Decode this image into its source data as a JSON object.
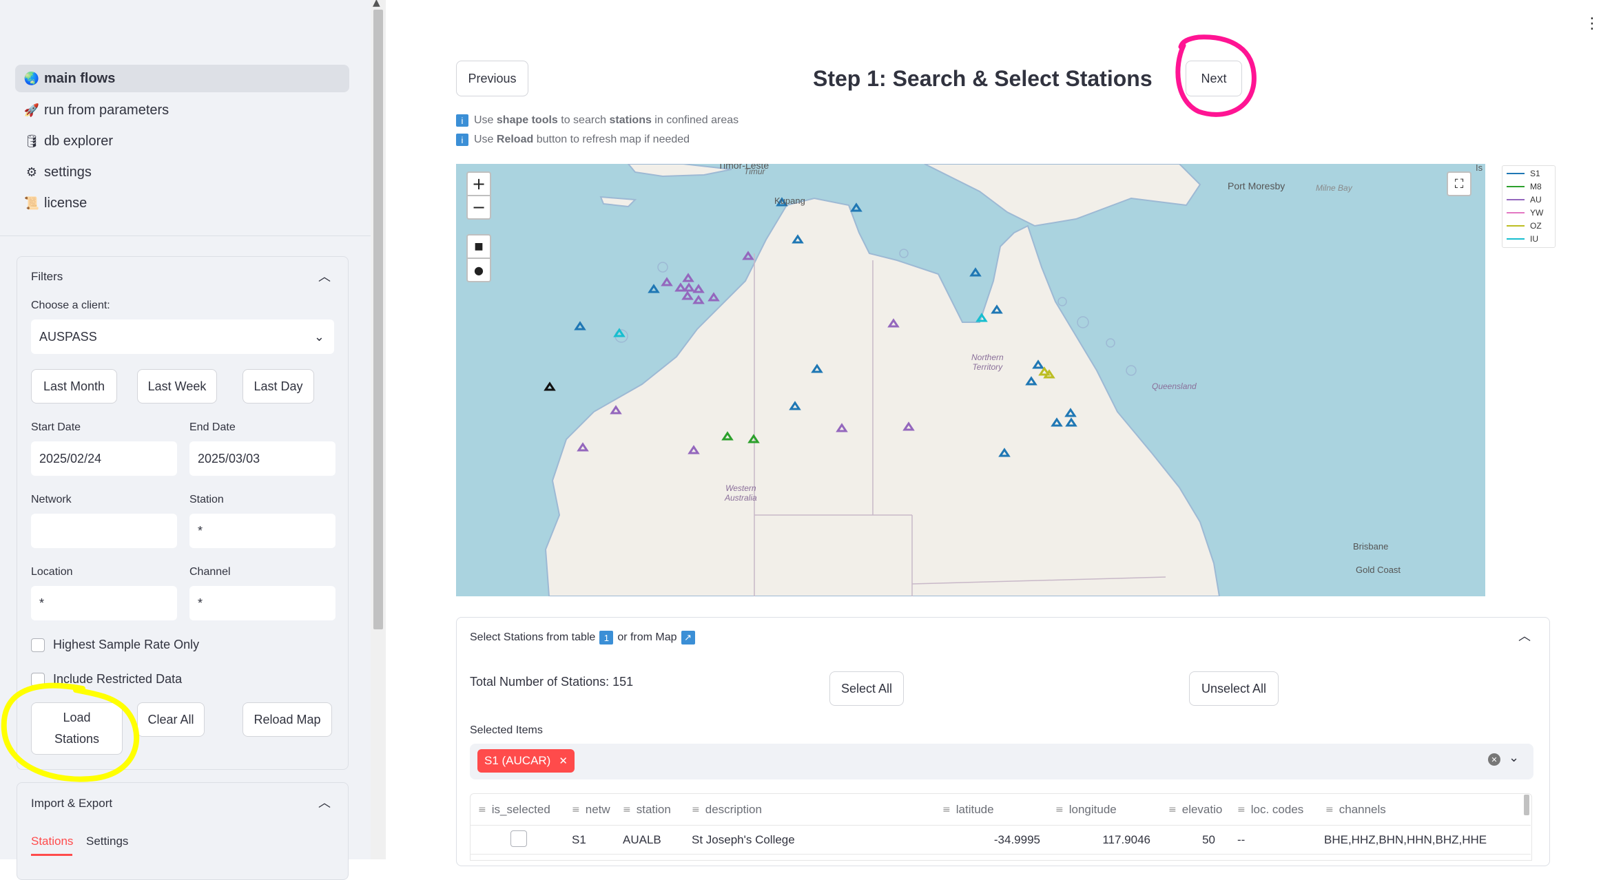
{
  "sidebar": {
    "nav": [
      {
        "icon": "globe-icon",
        "glyph": "🌏",
        "label": "main flows"
      },
      {
        "icon": "rocket-icon",
        "glyph": "🚀",
        "label": "run from parameters"
      },
      {
        "icon": "database-icon",
        "glyph": "🛢",
        "label": "db explorer"
      },
      {
        "icon": "gear-icon",
        "glyph": "⚙",
        "label": "settings"
      },
      {
        "icon": "scroll-icon",
        "glyph": "📜",
        "label": "license"
      }
    ],
    "filters": {
      "title": "Filters",
      "client_label": "Choose a client:",
      "client_value": "AUSPASS",
      "quick_ranges": [
        "Last Month",
        "Last Week",
        "Last Day"
      ],
      "start_date_label": "Start Date",
      "start_date": "2025/02/24",
      "end_date_label": "End Date",
      "end_date": "2025/03/03",
      "network_label": "Network",
      "network_value": "",
      "station_label": "Station",
      "station_value": "*",
      "location_label": "Location",
      "location_value": "*",
      "channel_label": "Channel",
      "channel_value": "*",
      "highest_sample_rate": "Highest Sample Rate Only",
      "include_restricted": "Include Restricted Data",
      "load_line1": "Load",
      "load_line2": "Stations",
      "clear_all": "Clear All",
      "reload_map": "Reload Map"
    },
    "import_export": {
      "title": "Import & Export",
      "tabs": [
        "Stations",
        "Settings"
      ],
      "active_tab": "Stations"
    }
  },
  "main": {
    "previous": "Previous",
    "next": "Next",
    "title": "Step 1: Search & Select Stations",
    "hints": [
      {
        "pre": "Use ",
        "bold": "shape tools",
        "mid": " to search ",
        "bold2": "stations",
        "post": " in confined areas"
      },
      {
        "pre": "Use ",
        "bold": "Reload",
        "mid": " button to refresh map if needed",
        "bold2": "",
        "post": ""
      }
    ],
    "map": {
      "labels": [
        "Timor-Leste",
        "Timur",
        "Kupang",
        "Port Moresby",
        "Milne Bay",
        "Northern",
        "Territory",
        "Queensland",
        "Western",
        "Australia",
        "Brisbane",
        "Gold Coast",
        "Is"
      ],
      "legend": [
        {
          "name": "S1",
          "color": "#1f77b4"
        },
        {
          "name": "M8",
          "color": "#2ca02c"
        },
        {
          "name": "AU",
          "color": "#9467bd"
        },
        {
          "name": "YW",
          "color": "#e377c2"
        },
        {
          "name": "OZ",
          "color": "#bcbd22"
        },
        {
          "name": "IU",
          "color": "#17becf"
        }
      ]
    },
    "stations_panel": {
      "heading": "Select Stations from table",
      "heading_mid": "or from Map",
      "total": "Total Number of Stations: 151",
      "select_all": "Select All",
      "unselect_all": "Unselect All",
      "selected_label": "Selected Items",
      "selected_tag": "S1 (AUCAR)",
      "columns": [
        "is_selected",
        "netw",
        "station",
        "description",
        "latitude",
        "longitude",
        "elevatio",
        "loc. codes",
        "channels"
      ],
      "rows": [
        {
          "network": "S1",
          "station": "AUALB",
          "description": "St Joseph's College",
          "latitude": "-34.9995",
          "longitude": "117.9046",
          "elevation": "50",
          "loc_codes": "--",
          "channels": "BHE,HHZ,BHN,HHN,BHZ,HHE"
        }
      ]
    }
  },
  "colors": {
    "accent_red": "#ff4b4b",
    "highlight_yellow": "#ffff00",
    "highlight_magenta": "#ff1493"
  }
}
